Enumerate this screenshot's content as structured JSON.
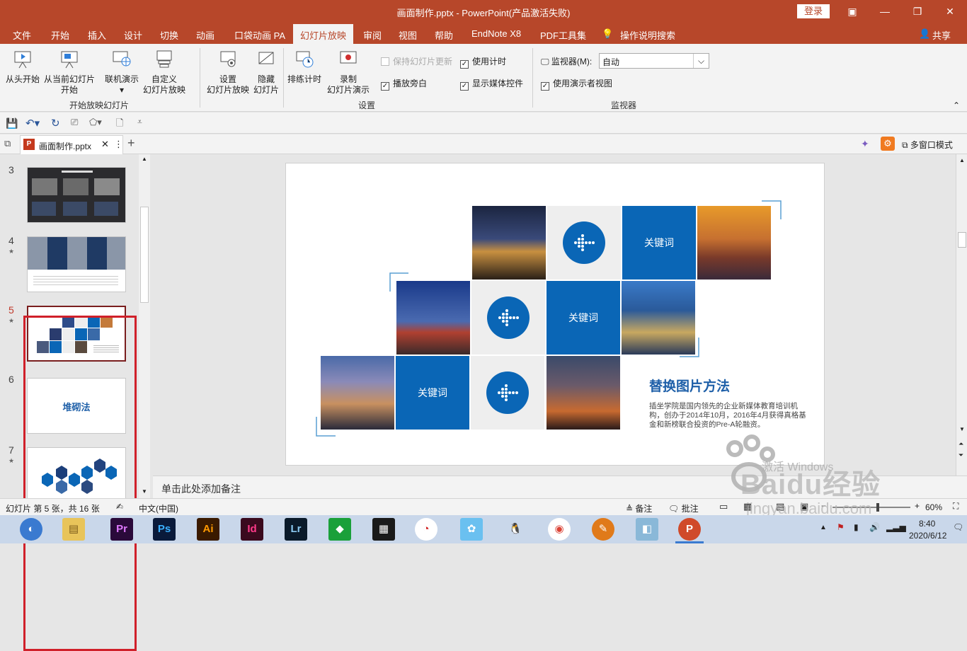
{
  "window": {
    "title": "画面制作.pptx  -  PowerPoint(产品激活失败)",
    "login_label": "登录",
    "controls": [
      "ribbon-display-icon",
      "minimize-icon",
      "restore-icon",
      "close-icon"
    ]
  },
  "ribbon_tabs": [
    "文件",
    "开始",
    "插入",
    "设计",
    "切换",
    "动画",
    "口袋动画 PA",
    "幻灯片放映",
    "审阅",
    "视图",
    "帮助",
    "EndNote X8",
    "PDF工具集",
    "操作说明搜索"
  ],
  "active_tab": "幻灯片放映",
  "share_label": "共享",
  "ribbon": {
    "group_start": {
      "label": "开始放映幻灯片",
      "from_beginning": "从头开始",
      "from_current_1": "从当前幻灯片",
      "from_current_2": "开始",
      "online_present": "联机演示",
      "custom_show_1": "自定义",
      "custom_show_2": "幻灯片放映"
    },
    "group_setup": {
      "label": "设置",
      "setup_show_1": "设置",
      "setup_show_2": "幻灯片放映",
      "hide_slide_1": "隐藏",
      "hide_slide_2": "幻灯片",
      "rehearse": "排练计时",
      "record_1": "录制",
      "record_2": "幻灯片演示",
      "keep_updated": "保持幻灯片更新",
      "play_narration": "播放旁白",
      "use_timings": "使用计时",
      "show_media_controls": "显示媒体控件"
    },
    "group_monitor": {
      "label": "监视器",
      "monitor_label": "监视器(M):",
      "monitor_value": "自动",
      "presenter_view": "使用演示者视图"
    }
  },
  "doc_tab": {
    "name": "画面制作.pptx",
    "multi_window": "多窗口模式"
  },
  "slides": [
    {
      "number": "3",
      "starred": false
    },
    {
      "number": "4",
      "starred": true
    },
    {
      "number": "5",
      "starred": true,
      "selected": true
    },
    {
      "number": "6",
      "starred": false,
      "title": "堆砌法"
    },
    {
      "number": "7",
      "starred": true
    }
  ],
  "slide": {
    "keyword": "关键词",
    "heading": "替换图片方法",
    "body": "插坐学院是国内领先的企业新媒体教育培训机构，创办于2014年10月，2016年4月获得真格基金和新榜联合投资的Pre-A轮融资。"
  },
  "notes_placeholder": "单击此处添加备注",
  "status": {
    "slide_info": "幻灯片 第 5 张，共 16 张",
    "language": "中文(中国)",
    "notes": "备注",
    "comments": "批注",
    "zoom": "60%"
  },
  "taskbar": {
    "time": "8:40",
    "date": "2020/6/12"
  },
  "colors": {
    "accent": "#b7472a",
    "slide_blue": "#0a66b6",
    "highlight_red": "#d0202a"
  },
  "watermark": {
    "text1": "Baidu经验",
    "text2": "jingyan.baidu.com",
    "activate": "激活 Windows"
  }
}
